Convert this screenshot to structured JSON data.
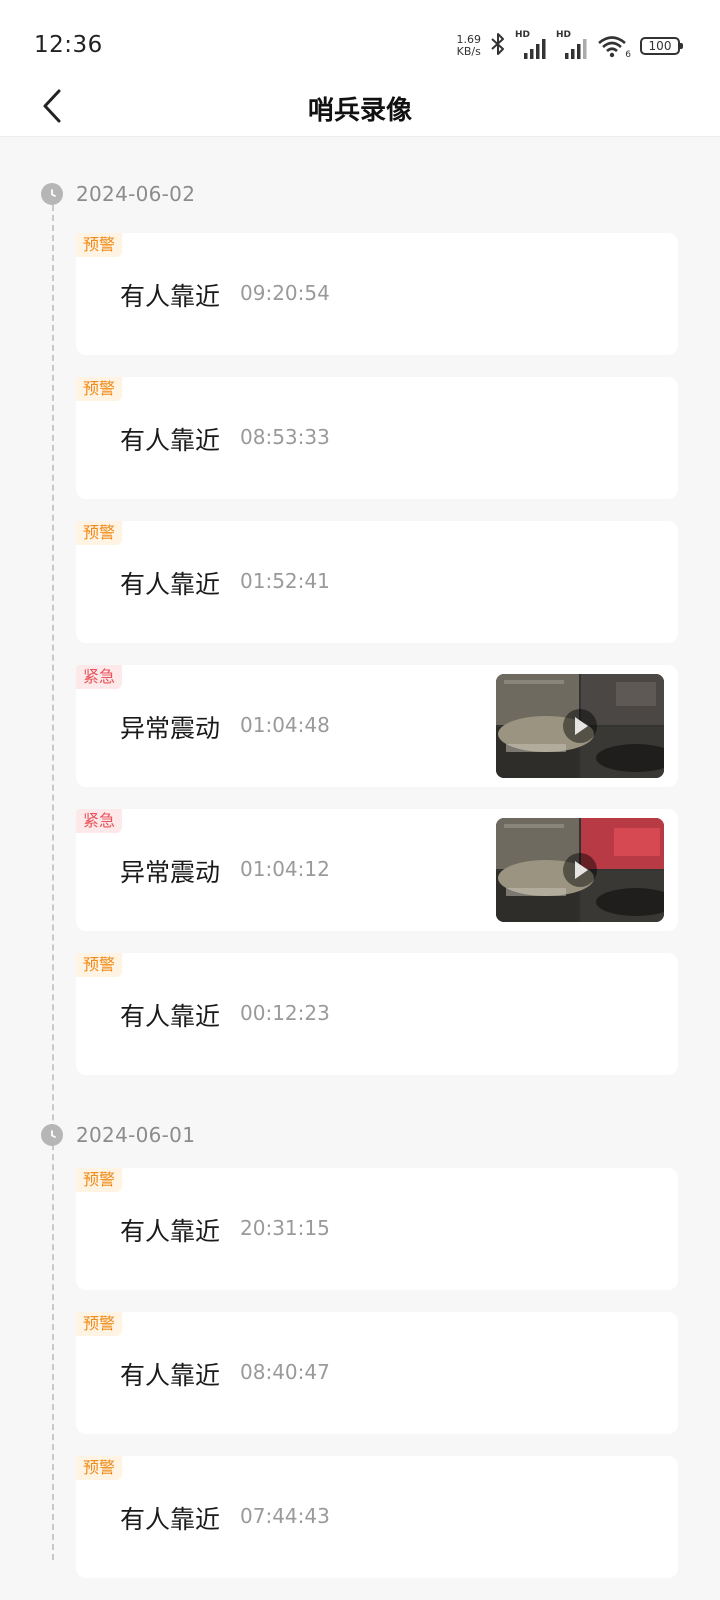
{
  "status_bar": {
    "time": "12:36",
    "net_speed_value": "1.69",
    "net_speed_unit": "KB/s",
    "hd1": "HD",
    "hd2": "HD",
    "wifi_badge": "6",
    "battery": "100"
  },
  "header": {
    "title": "哨兵录像"
  },
  "colors": {
    "warn": "#f08a19",
    "urgent": "#e8545b",
    "date_text": "#8c8c8c",
    "time_text": "#9a9a9a"
  },
  "groups": [
    {
      "date": "2024-06-02",
      "records": [
        {
          "badge": "预警",
          "level": "warn",
          "event": "有人靠近",
          "time": "09:20:54",
          "has_thumbnail": false
        },
        {
          "badge": "预警",
          "level": "warn",
          "event": "有人靠近",
          "time": "08:53:33",
          "has_thumbnail": false
        },
        {
          "badge": "预警",
          "level": "warn",
          "event": "有人靠近",
          "time": "01:52:41",
          "has_thumbnail": false
        },
        {
          "badge": "紧急",
          "level": "urgent",
          "event": "异常震动",
          "time": "01:04:48",
          "has_thumbnail": true
        },
        {
          "badge": "紧急",
          "level": "urgent",
          "event": "异常震动",
          "time": "01:04:12",
          "has_thumbnail": true
        },
        {
          "badge": "预警",
          "level": "warn",
          "event": "有人靠近",
          "time": "00:12:23",
          "has_thumbnail": false
        }
      ]
    },
    {
      "date": "2024-06-01",
      "records": [
        {
          "badge": "预警",
          "level": "warn",
          "event": "有人靠近",
          "time": "20:31:15",
          "has_thumbnail": false
        },
        {
          "badge": "预警",
          "level": "warn",
          "event": "有人靠近",
          "time": "08:40:47",
          "has_thumbnail": false
        },
        {
          "badge": "预警",
          "level": "warn",
          "event": "有人靠近",
          "time": "07:44:43",
          "has_thumbnail": false
        }
      ]
    }
  ]
}
